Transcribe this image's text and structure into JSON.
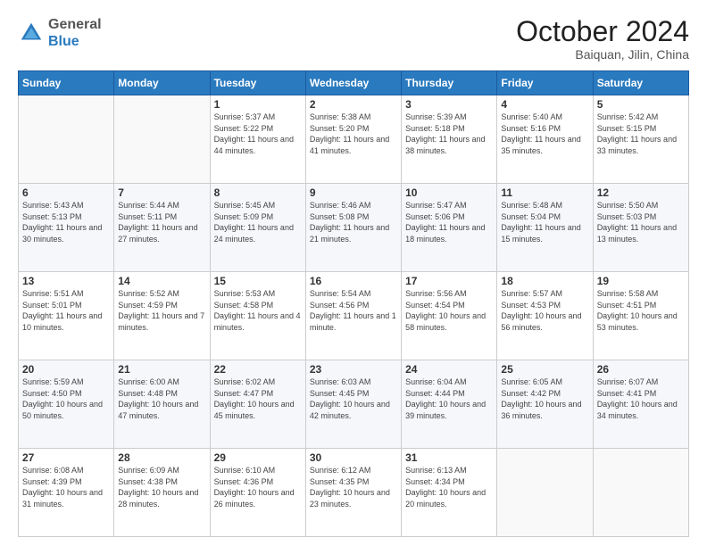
{
  "header": {
    "logo_general": "General",
    "logo_blue": "Blue",
    "month_title": "October 2024",
    "location": "Baiquan, Jilin, China"
  },
  "days_of_week": [
    "Sunday",
    "Monday",
    "Tuesday",
    "Wednesday",
    "Thursday",
    "Friday",
    "Saturday"
  ],
  "weeks": [
    [
      {
        "day": "",
        "info": ""
      },
      {
        "day": "",
        "info": ""
      },
      {
        "day": "1",
        "info": "Sunrise: 5:37 AM\nSunset: 5:22 PM\nDaylight: 11 hours and 44 minutes."
      },
      {
        "day": "2",
        "info": "Sunrise: 5:38 AM\nSunset: 5:20 PM\nDaylight: 11 hours and 41 minutes."
      },
      {
        "day": "3",
        "info": "Sunrise: 5:39 AM\nSunset: 5:18 PM\nDaylight: 11 hours and 38 minutes."
      },
      {
        "day": "4",
        "info": "Sunrise: 5:40 AM\nSunset: 5:16 PM\nDaylight: 11 hours and 35 minutes."
      },
      {
        "day": "5",
        "info": "Sunrise: 5:42 AM\nSunset: 5:15 PM\nDaylight: 11 hours and 33 minutes."
      }
    ],
    [
      {
        "day": "6",
        "info": "Sunrise: 5:43 AM\nSunset: 5:13 PM\nDaylight: 11 hours and 30 minutes."
      },
      {
        "day": "7",
        "info": "Sunrise: 5:44 AM\nSunset: 5:11 PM\nDaylight: 11 hours and 27 minutes."
      },
      {
        "day": "8",
        "info": "Sunrise: 5:45 AM\nSunset: 5:09 PM\nDaylight: 11 hours and 24 minutes."
      },
      {
        "day": "9",
        "info": "Sunrise: 5:46 AM\nSunset: 5:08 PM\nDaylight: 11 hours and 21 minutes."
      },
      {
        "day": "10",
        "info": "Sunrise: 5:47 AM\nSunset: 5:06 PM\nDaylight: 11 hours and 18 minutes."
      },
      {
        "day": "11",
        "info": "Sunrise: 5:48 AM\nSunset: 5:04 PM\nDaylight: 11 hours and 15 minutes."
      },
      {
        "day": "12",
        "info": "Sunrise: 5:50 AM\nSunset: 5:03 PM\nDaylight: 11 hours and 13 minutes."
      }
    ],
    [
      {
        "day": "13",
        "info": "Sunrise: 5:51 AM\nSunset: 5:01 PM\nDaylight: 11 hours and 10 minutes."
      },
      {
        "day": "14",
        "info": "Sunrise: 5:52 AM\nSunset: 4:59 PM\nDaylight: 11 hours and 7 minutes."
      },
      {
        "day": "15",
        "info": "Sunrise: 5:53 AM\nSunset: 4:58 PM\nDaylight: 11 hours and 4 minutes."
      },
      {
        "day": "16",
        "info": "Sunrise: 5:54 AM\nSunset: 4:56 PM\nDaylight: 11 hours and 1 minute."
      },
      {
        "day": "17",
        "info": "Sunrise: 5:56 AM\nSunset: 4:54 PM\nDaylight: 10 hours and 58 minutes."
      },
      {
        "day": "18",
        "info": "Sunrise: 5:57 AM\nSunset: 4:53 PM\nDaylight: 10 hours and 56 minutes."
      },
      {
        "day": "19",
        "info": "Sunrise: 5:58 AM\nSunset: 4:51 PM\nDaylight: 10 hours and 53 minutes."
      }
    ],
    [
      {
        "day": "20",
        "info": "Sunrise: 5:59 AM\nSunset: 4:50 PM\nDaylight: 10 hours and 50 minutes."
      },
      {
        "day": "21",
        "info": "Sunrise: 6:00 AM\nSunset: 4:48 PM\nDaylight: 10 hours and 47 minutes."
      },
      {
        "day": "22",
        "info": "Sunrise: 6:02 AM\nSunset: 4:47 PM\nDaylight: 10 hours and 45 minutes."
      },
      {
        "day": "23",
        "info": "Sunrise: 6:03 AM\nSunset: 4:45 PM\nDaylight: 10 hours and 42 minutes."
      },
      {
        "day": "24",
        "info": "Sunrise: 6:04 AM\nSunset: 4:44 PM\nDaylight: 10 hours and 39 minutes."
      },
      {
        "day": "25",
        "info": "Sunrise: 6:05 AM\nSunset: 4:42 PM\nDaylight: 10 hours and 36 minutes."
      },
      {
        "day": "26",
        "info": "Sunrise: 6:07 AM\nSunset: 4:41 PM\nDaylight: 10 hours and 34 minutes."
      }
    ],
    [
      {
        "day": "27",
        "info": "Sunrise: 6:08 AM\nSunset: 4:39 PM\nDaylight: 10 hours and 31 minutes."
      },
      {
        "day": "28",
        "info": "Sunrise: 6:09 AM\nSunset: 4:38 PM\nDaylight: 10 hours and 28 minutes."
      },
      {
        "day": "29",
        "info": "Sunrise: 6:10 AM\nSunset: 4:36 PM\nDaylight: 10 hours and 26 minutes."
      },
      {
        "day": "30",
        "info": "Sunrise: 6:12 AM\nSunset: 4:35 PM\nDaylight: 10 hours and 23 minutes."
      },
      {
        "day": "31",
        "info": "Sunrise: 6:13 AM\nSunset: 4:34 PM\nDaylight: 10 hours and 20 minutes."
      },
      {
        "day": "",
        "info": ""
      },
      {
        "day": "",
        "info": ""
      }
    ]
  ]
}
